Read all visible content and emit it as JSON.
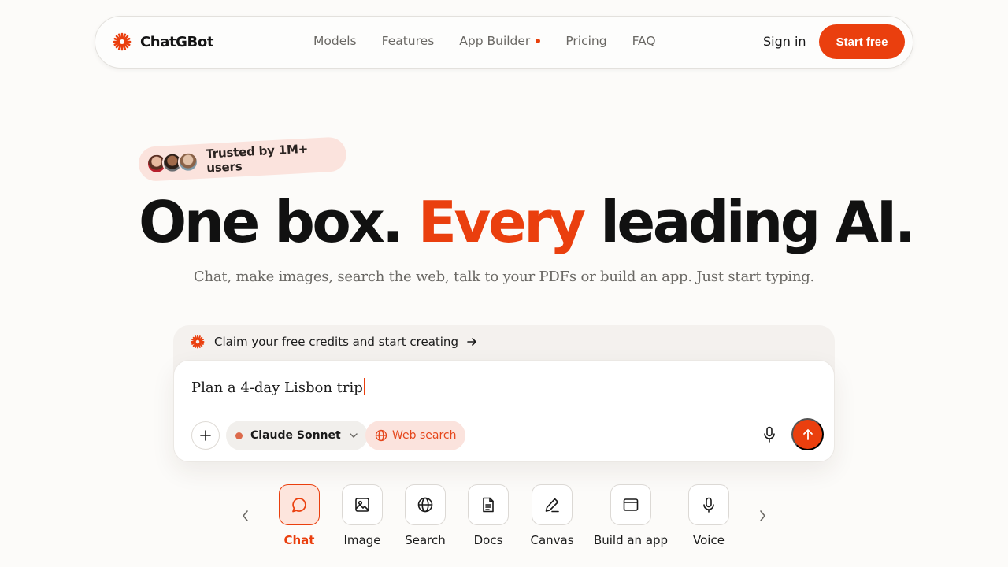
{
  "brand": {
    "name": "ChatGBot",
    "accent": "#ea3f0e"
  },
  "nav": {
    "items": [
      {
        "label": "Models"
      },
      {
        "label": "Features"
      },
      {
        "label": "App Builder",
        "has_dot": true
      },
      {
        "label": "Pricing"
      },
      {
        "label": "FAQ"
      }
    ],
    "signin": "Sign in",
    "cta": "Start free"
  },
  "hero": {
    "trusted": "Trusted by 1M+ users",
    "headline_part1": "One box.",
    "headline_accent": "Every",
    "headline_part2": "leading AI.",
    "subtitle": "Chat, make images, search the web, talk to your PDFs or build an app. Just start typing."
  },
  "prompt": {
    "claim": "Claim your free credits and start creating",
    "value": "Plan a 4-day Lisbon trip",
    "model": "Claude Sonnet",
    "web_search": "Web search"
  },
  "modes": [
    {
      "label": "Chat",
      "icon": "chat-icon",
      "active": true
    },
    {
      "label": "Image",
      "icon": "image-icon"
    },
    {
      "label": "Search",
      "icon": "globe-icon"
    },
    {
      "label": "Docs",
      "icon": "document-icon"
    },
    {
      "label": "Canvas",
      "icon": "pen-icon"
    },
    {
      "label": "Build an app",
      "icon": "browser-window-icon"
    },
    {
      "label": "Voice",
      "icon": "microphone-icon"
    }
  ]
}
